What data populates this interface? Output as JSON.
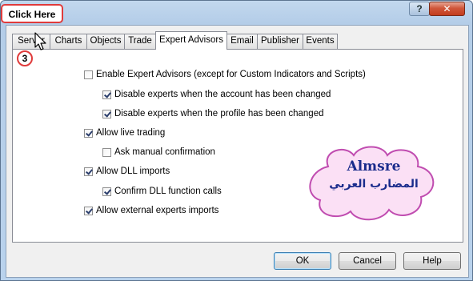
{
  "titlebar": {
    "help_label": "?",
    "close_label": "✕"
  },
  "annotation": {
    "callout": "Click Here",
    "step": "3"
  },
  "tabs": [
    {
      "label": "Server"
    },
    {
      "label": "Charts"
    },
    {
      "label": "Objects"
    },
    {
      "label": "Trade"
    },
    {
      "label": "Expert Advisors"
    },
    {
      "label": "Email"
    },
    {
      "label": "Publisher"
    },
    {
      "label": "Events"
    }
  ],
  "active_tab": "Expert Advisors",
  "options": [
    {
      "label": "Enable Expert Advisors (except for Custom Indicators and Scripts)",
      "checked": false
    },
    {
      "label": "Disable experts when the account has been changed",
      "checked": true
    },
    {
      "label": "Disable experts when the profile has been changed",
      "checked": true
    },
    {
      "label": "Allow live trading",
      "checked": true
    },
    {
      "label": "Ask manual confirmation",
      "checked": false
    },
    {
      "label": "Allow DLL imports",
      "checked": true
    },
    {
      "label": "Confirm DLL function calls",
      "checked": true
    },
    {
      "label": "Allow external experts imports",
      "checked": true
    }
  ],
  "watermark": {
    "line1": "Almsre",
    "line2": "المضارب العربي"
  },
  "buttons": {
    "ok": "OK",
    "cancel": "Cancel",
    "help": "Help"
  },
  "colors": {
    "callout_border": "#e03b3b",
    "watermark_text": "#1a2c8c",
    "cloud_fill": "#fbe0f5",
    "cloud_stroke": "#c04cb0"
  }
}
